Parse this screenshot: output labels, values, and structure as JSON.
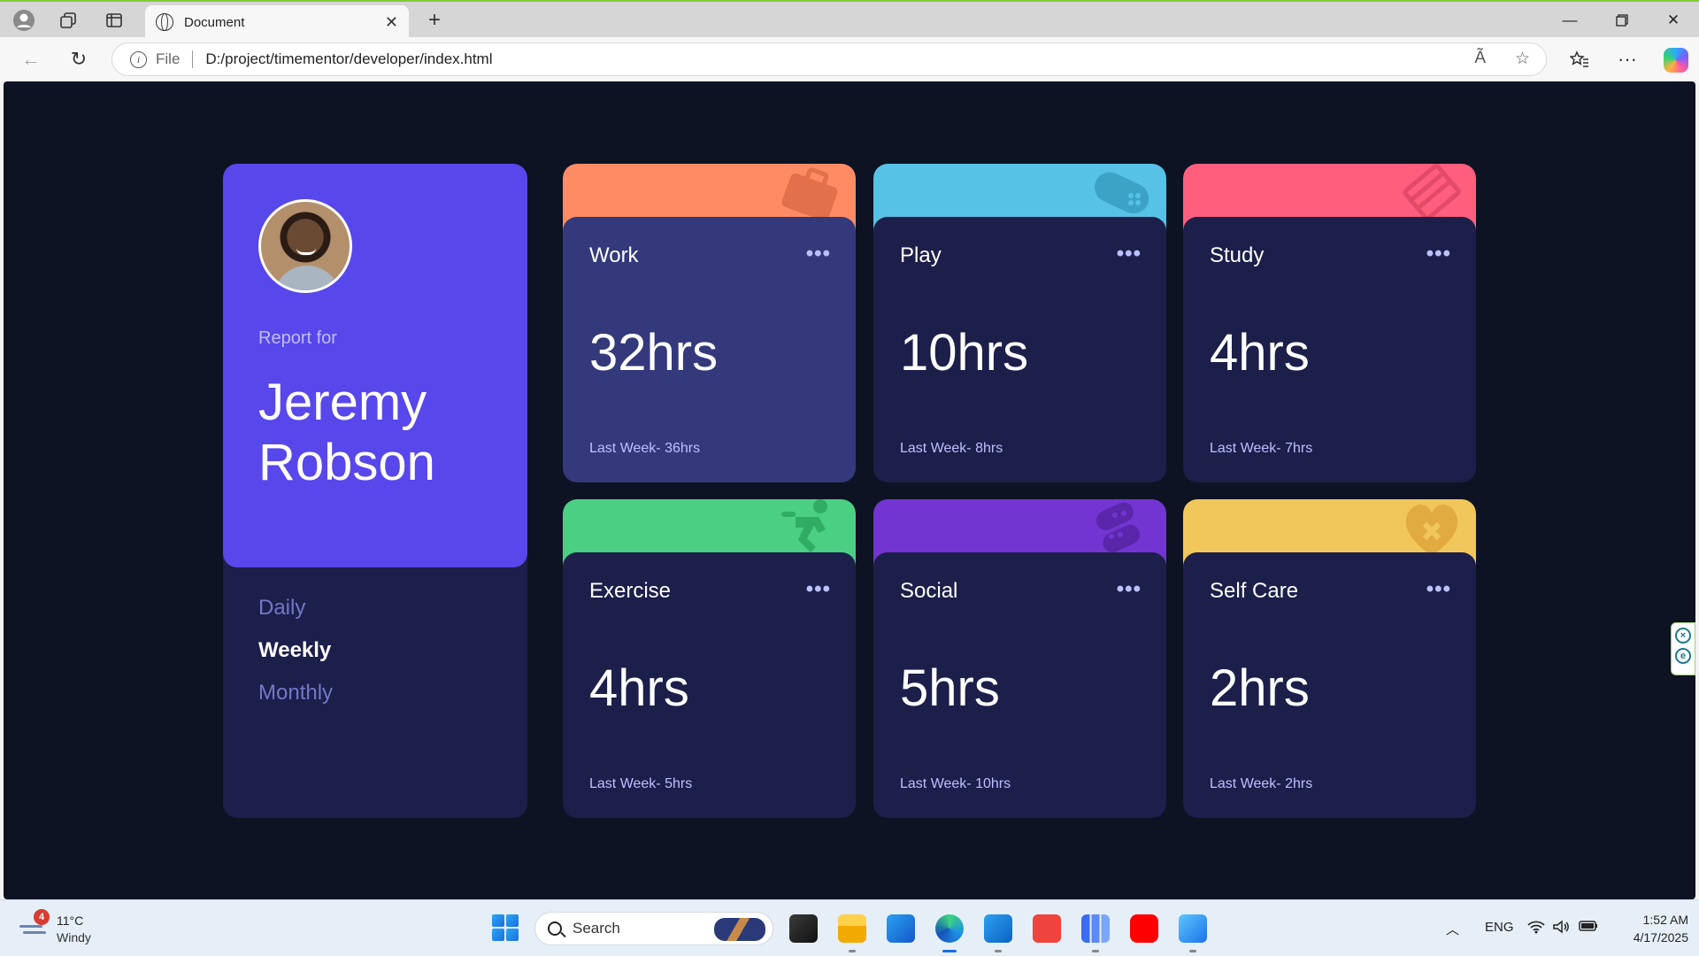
{
  "browser": {
    "tab_title": "Document",
    "address_prefix": "File",
    "url": "D:/project/timementor/developer/index.html",
    "icons": [
      "profile-icon",
      "workspaces-icon",
      "tab-actions-icon",
      "globe-icon",
      "close-tab-icon",
      "new-tab-icon",
      "minimize-icon",
      "restore-icon",
      "close-window-icon",
      "back-icon",
      "reload-icon",
      "info-icon",
      "read-aloud-icon",
      "favorite-icon",
      "favorites-icon",
      "more-icon",
      "copilot-icon"
    ]
  },
  "profile": {
    "report_for": "Report for",
    "name_line1": "Jeremy",
    "name_line2": "Robson",
    "periods": [
      "Daily",
      "Weekly",
      "Monthly"
    ],
    "active_period": "Weekly"
  },
  "cards": [
    {
      "title": "Work",
      "hours": "32hrs",
      "previous": "Last Week- 36hrs",
      "color": "#ff8b64",
      "icon": "briefcase-icon",
      "highlighted": true
    },
    {
      "title": "Play",
      "hours": "10hrs",
      "previous": "Last Week- 8hrs",
      "color": "#55c2e6",
      "icon": "gamepad-icon"
    },
    {
      "title": "Study",
      "hours": "4hrs",
      "previous": "Last Week- 7hrs",
      "color": "#ff5e7d",
      "icon": "book-icon"
    },
    {
      "title": "Exercise",
      "hours": "4hrs",
      "previous": "Last Week- 5hrs",
      "color": "#4bcf82",
      "icon": "runner-icon"
    },
    {
      "title": "Social",
      "hours": "5hrs",
      "previous": "Last Week- 10hrs",
      "color": "#7335d2",
      "icon": "chat-icon"
    },
    {
      "title": "Self Care",
      "hours": "2hrs",
      "previous": "Last Week- 2hrs",
      "color": "#f1c75b",
      "icon": "heart-icon"
    }
  ],
  "card_menu": "•••",
  "taskbar": {
    "weather_badge": "4",
    "temperature": "11°C",
    "condition": "Windy",
    "search_label": "Search",
    "language": "ENG",
    "time": "1:52 AM",
    "date": "4/17/2025",
    "apps": [
      "task-view-icon",
      "file-explorer-icon",
      "store-icon",
      "edge-icon",
      "vscode-icon",
      "anydesk-icon",
      "analytics-icon",
      "youtube-icon",
      "photos-icon"
    ]
  },
  "side_tools": {
    "close_symbol": "×",
    "e_symbol": "e"
  }
}
